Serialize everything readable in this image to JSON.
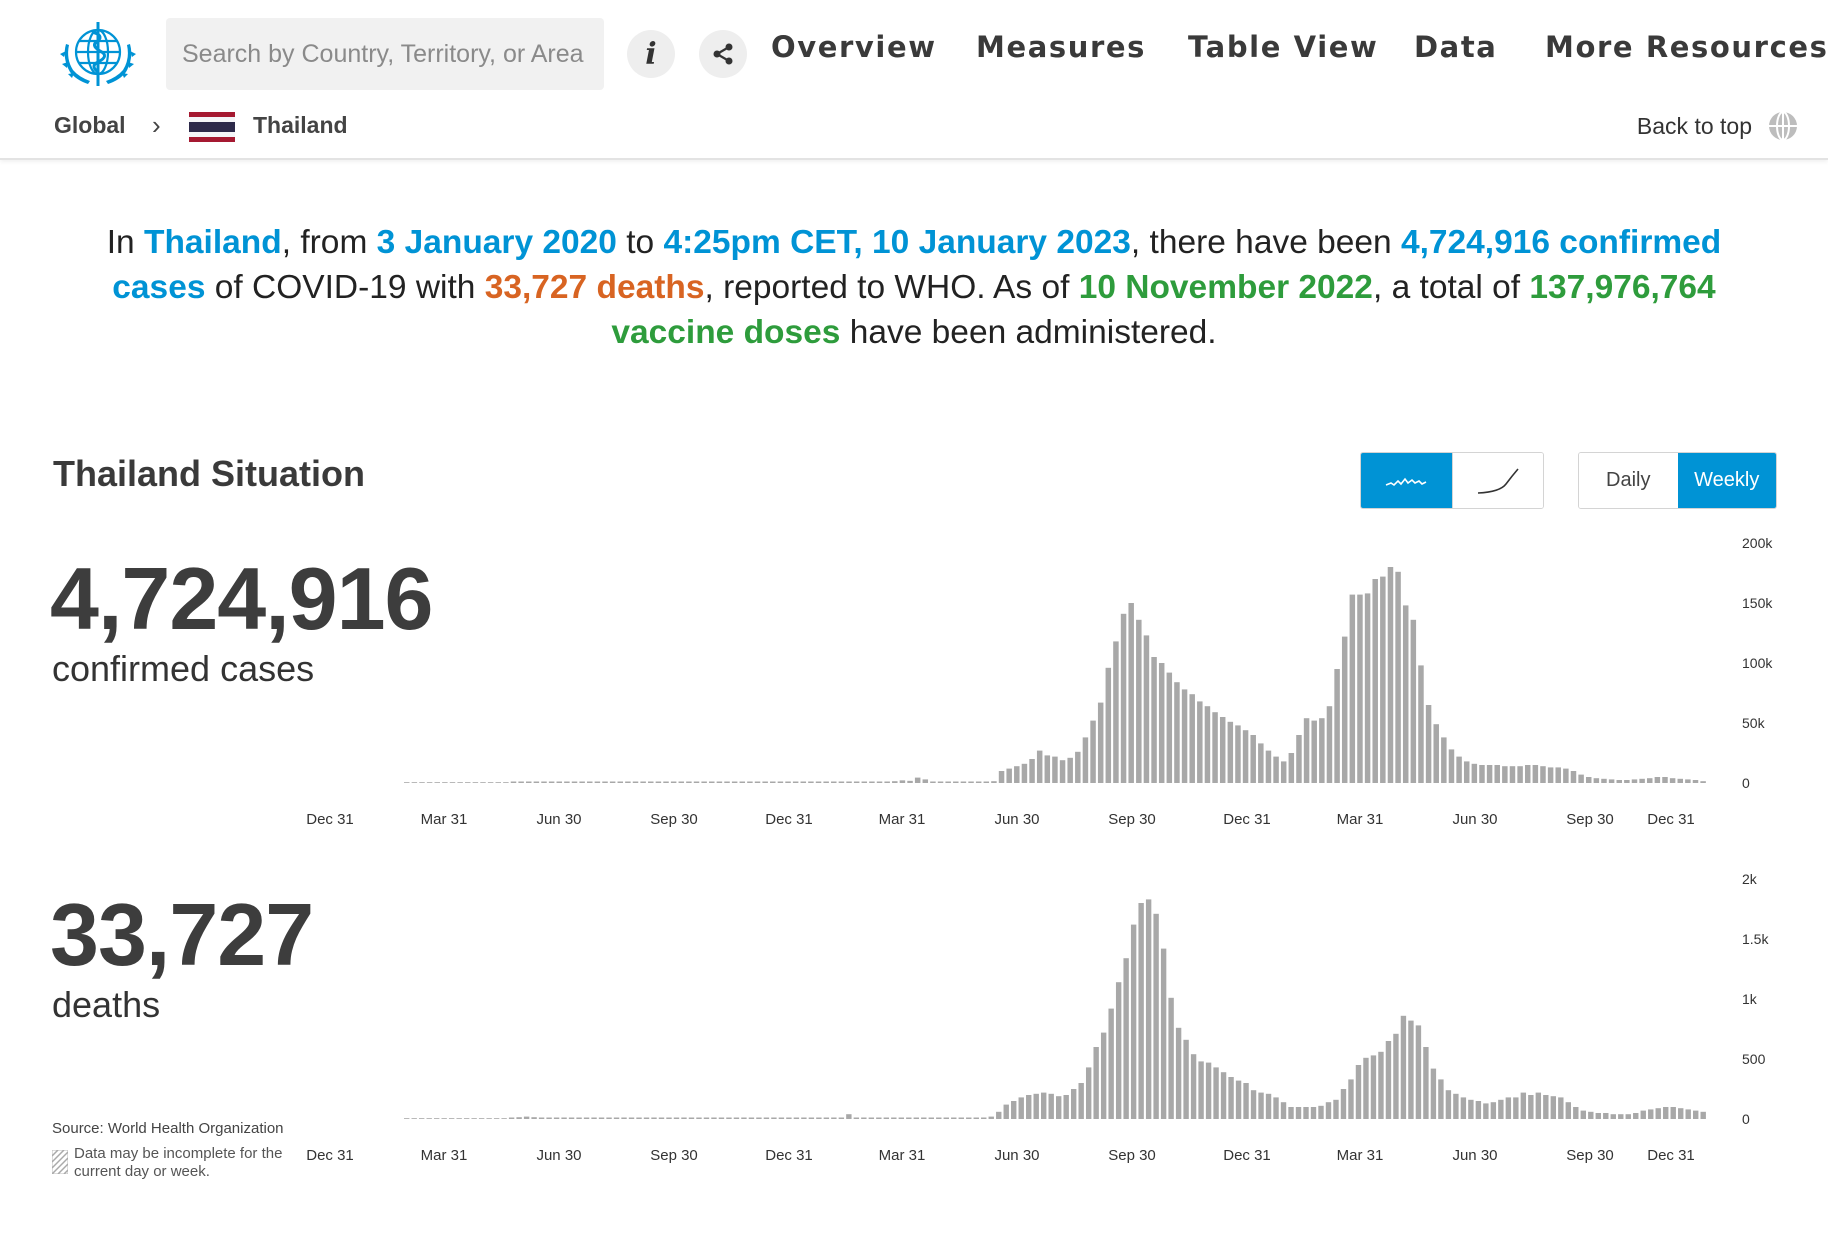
{
  "header": {
    "search_placeholder": "Search by Country, Territory, or Area",
    "info_icon": "info-icon",
    "share_icon": "share-icon",
    "nav": [
      "Overview",
      "Measures",
      "Table View",
      "Data",
      "More Resources"
    ],
    "breadcrumb": {
      "root": "Global",
      "separator": "›",
      "country": "Thailand"
    },
    "back_to_top": "Back to top"
  },
  "summary": {
    "p1": "In ",
    "country": "Thailand",
    "p2": ", from ",
    "date_from": "3 January 2020",
    "p3": " to ",
    "date_to": "4:25pm CET, 10 January 2023",
    "p4": ", there have been ",
    "confirmed": "4,724,916 confirmed cases",
    "p5": " of COVID-19 with ",
    "deaths": "33,727 deaths",
    "p6": ", reported to WHO. As of ",
    "vacc_date": "10 November 2022",
    "p7": ", a total of ",
    "vaccines": "137,976,764 vaccine doses",
    "p8": " have been administered."
  },
  "situation": {
    "title": "Thailand Situation",
    "toggle_daily": "Daily",
    "toggle_weekly": "Weekly",
    "mode_icons": [
      "trend-wave-icon",
      "cumulative-curve-icon"
    ],
    "cases_total": "4,724,916",
    "cases_label": "confirmed cases",
    "deaths_total": "33,727",
    "deaths_label": "deaths",
    "source": "Source: World Health Organization",
    "note": "Data may be incomplete for the current day or week."
  },
  "colors": {
    "accent": "#0093d5",
    "deaths_text": "#d86422",
    "vaccine_text": "#2e9c3c",
    "bar": "#a8a8a8"
  },
  "chart_data": [
    {
      "type": "bar",
      "name": "confirmed cases weekly",
      "x_ticks": [
        "Dec 31",
        "Mar 31",
        "Jun 30",
        "Sep 30",
        "Dec 31",
        "Mar 31",
        "Jun 30",
        "Sep 30",
        "Dec 31",
        "Mar 31",
        "Jun 30",
        "Sep 30",
        "Dec 31"
      ],
      "y_ticks": [
        "200k",
        "150k",
        "100k",
        "50k",
        "0"
      ],
      "ylim": [
        0,
        200000
      ],
      "values": [
        0,
        0,
        0,
        0,
        0,
        0,
        0,
        0,
        0,
        0,
        0,
        0,
        0,
        0,
        200,
        800,
        1200,
        1000,
        600,
        300,
        200,
        100,
        100,
        50,
        50,
        50,
        50,
        50,
        50,
        50,
        50,
        50,
        50,
        50,
        50,
        50,
        50,
        50,
        50,
        50,
        50,
        50,
        50,
        50,
        50,
        50,
        50,
        50,
        50,
        50,
        50,
        50,
        50,
        50,
        50,
        50,
        50,
        50,
        50,
        50,
        50,
        50,
        50,
        800,
        1500,
        2200,
        1800,
        4500,
        3000,
        1200,
        1000,
        800,
        700,
        600,
        600,
        700,
        1000,
        1500,
        10000,
        12000,
        14000,
        16000,
        20000,
        27000,
        23000,
        22000,
        19000,
        21000,
        26000,
        38000,
        52000,
        67000,
        96000,
        118000,
        141000,
        150000,
        136000,
        123000,
        105000,
        100000,
        92000,
        84000,
        78000,
        74000,
        68000,
        64000,
        59000,
        55000,
        51000,
        48000,
        44000,
        40000,
        33000,
        27000,
        22000,
        18000,
        25000,
        40000,
        54000,
        52000,
        54000,
        64000,
        95000,
        122000,
        157000,
        157000,
        158000,
        170000,
        172000,
        180000,
        176000,
        148000,
        136000,
        98000,
        65000,
        49000,
        38000,
        28000,
        22000,
        18000,
        16000,
        15000,
        15000,
        15000,
        14000,
        14000,
        14000,
        15000,
        15000,
        14000,
        13000,
        13000,
        12000,
        10000,
        7000,
        5000,
        4000,
        3500,
        3000,
        2500,
        2500,
        3000,
        3500,
        4000,
        5000,
        5000,
        4000,
        3500,
        3000,
        2500,
        1500
      ]
    },
    {
      "type": "bar",
      "name": "deaths weekly",
      "x_ticks": [
        "Dec 31",
        "Mar 31",
        "Jun 30",
        "Sep 30",
        "Dec 31",
        "Mar 31",
        "Jun 30",
        "Sep 30",
        "Dec 31",
        "Mar 31",
        "Jun 30",
        "Sep 30",
        "Dec 31"
      ],
      "y_ticks": [
        "2k",
        "1.5k",
        "1k",
        "500",
        "0"
      ],
      "ylim": [
        0,
        2000
      ],
      "values": [
        0,
        0,
        0,
        0,
        0,
        0,
        0,
        0,
        0,
        0,
        0,
        0,
        0,
        0,
        5,
        15,
        20,
        15,
        10,
        5,
        3,
        2,
        1,
        1,
        1,
        1,
        1,
        1,
        1,
        1,
        1,
        1,
        1,
        1,
        1,
        1,
        1,
        1,
        1,
        1,
        1,
        1,
        1,
        1,
        1,
        1,
        1,
        1,
        1,
        1,
        1,
        1,
        1,
        1,
        1,
        1,
        1,
        1,
        1,
        40,
        5,
        5,
        5,
        5,
        5,
        5,
        5,
        5,
        5,
        5,
        5,
        5,
        5,
        5,
        5,
        5,
        5,
        10,
        20,
        60,
        120,
        150,
        180,
        200,
        210,
        220,
        210,
        190,
        200,
        250,
        300,
        430,
        600,
        720,
        920,
        1140,
        1340,
        1620,
        1800,
        1830,
        1710,
        1420,
        1010,
        760,
        660,
        540,
        480,
        470,
        430,
        390,
        350,
        320,
        300,
        240,
        220,
        210,
        180,
        140,
        100,
        100,
        100,
        100,
        110,
        140,
        160,
        250,
        330,
        450,
        510,
        530,
        560,
        650,
        710,
        860,
        820,
        780,
        600,
        420,
        330,
        240,
        210,
        180,
        160,
        150,
        130,
        140,
        160,
        180,
        180,
        220,
        200,
        220,
        200,
        190,
        180,
        140,
        100,
        70,
        60,
        50,
        50,
        40,
        40,
        40,
        50,
        70,
        80,
        90,
        100,
        100,
        90,
        80,
        70,
        60
      ]
    }
  ]
}
